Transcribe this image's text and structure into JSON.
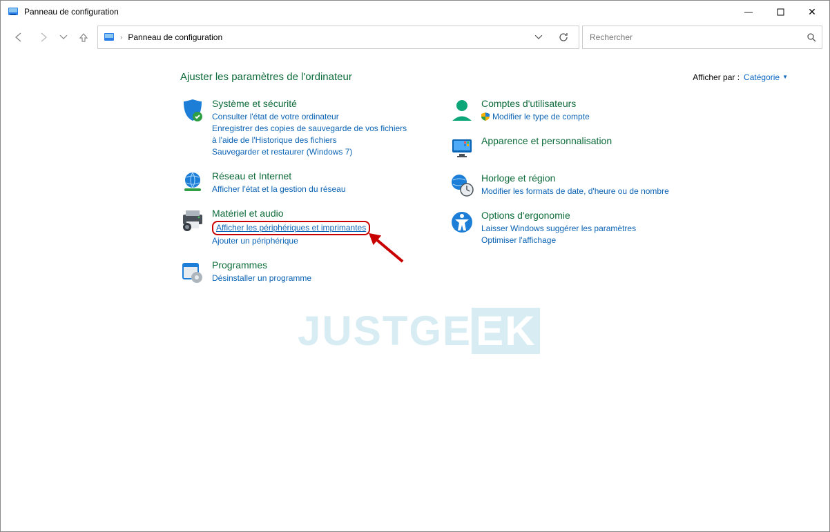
{
  "window": {
    "title": "Panneau de configuration"
  },
  "breadcrumb": {
    "root": "Panneau de configuration"
  },
  "search": {
    "placeholder": "Rechercher"
  },
  "heading": "Ajuster les paramètres de l'ordinateur",
  "viewby": {
    "label": "Afficher par :",
    "value": "Catégorie"
  },
  "watermark": {
    "left": "JUSTGE",
    "right": "EK"
  },
  "left_col": [
    {
      "title": "Système et sécurité",
      "links": [
        "Consulter l'état de votre ordinateur",
        "Enregistrer des copies de sauvegarde de vos fichiers à l'aide de l'Historique des fichiers",
        "Sauvegarder et restaurer (Windows 7)"
      ]
    },
    {
      "title": "Réseau et Internet",
      "links": [
        "Afficher l'état et la gestion du réseau"
      ]
    },
    {
      "title": "Matériel et audio",
      "highlighted_link": "Afficher les périphériques et imprimantes",
      "links": [
        "Ajouter un périphérique"
      ]
    },
    {
      "title": "Programmes",
      "links": [
        "Désinstaller un programme"
      ]
    }
  ],
  "right_col": [
    {
      "title": "Comptes d'utilisateurs",
      "shield_link": "Modifier le type de compte"
    },
    {
      "title": "Apparence et personnalisation",
      "links": []
    },
    {
      "title": "Horloge et région",
      "links": [
        "Modifier les formats de date, d'heure ou de nombre"
      ]
    },
    {
      "title": "Options d'ergonomie",
      "links": [
        "Laisser Windows suggérer les paramètres",
        "Optimiser l'affichage"
      ]
    }
  ]
}
